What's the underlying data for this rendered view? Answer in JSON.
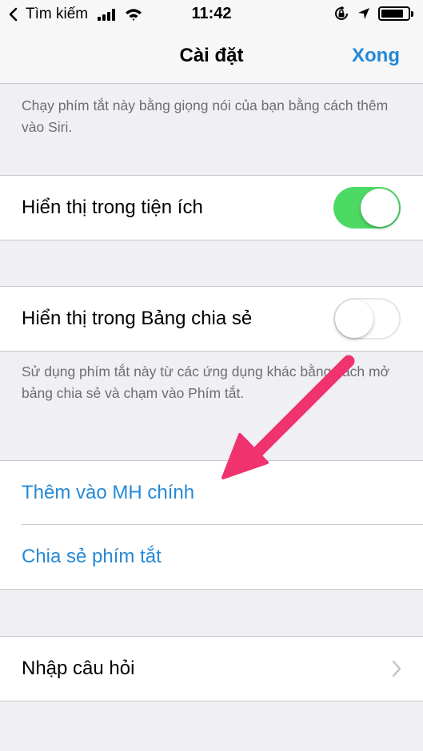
{
  "status_bar": {
    "back_label": "Tìm kiếm",
    "time": "11:42",
    "battery_level": 0.85
  },
  "nav": {
    "title": "Cài đặt",
    "done_label": "Xong"
  },
  "siri_section": {
    "footer": "Chạy phím tắt này bằng giọng nói của bạn bằng cách thêm vào Siri."
  },
  "widget_section": {
    "label": "Hiển thị trong tiện ích",
    "toggle_on": true
  },
  "share_sheet_section": {
    "label": "Hiển thị trong Bảng chia sẻ",
    "toggle_on": false,
    "footer": "Sử dụng phím tắt này từ các ứng dụng khác bằng cách mở bảng chia sẻ và chạm vào Phím tắt."
  },
  "actions_section": {
    "add_home_label": "Thêm vào MH chính",
    "share_label": "Chia sẻ phím tắt"
  },
  "question_section": {
    "label": "Nhập câu hỏi"
  },
  "colors": {
    "accent": "#2589d6",
    "toggle_on": "#4cd964",
    "annotation_arrow": "#f0326e",
    "background": "#efeff4"
  },
  "icons": {
    "back": "chevron-left-icon",
    "signal": "cellular-signal-icon",
    "wifi": "wifi-icon",
    "rotation_lock": "rotation-lock-icon",
    "location": "location-arrow-icon",
    "battery": "battery-icon",
    "disclosure": "chevron-right-icon"
  }
}
